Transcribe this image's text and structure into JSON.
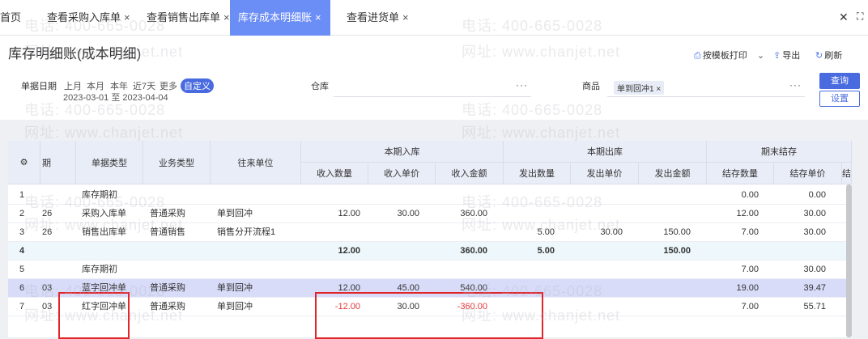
{
  "tabs": [
    {
      "label": "首页",
      "closable": false
    },
    {
      "label": "查看采购入库单",
      "closable": true
    },
    {
      "label": "查看销售出库单",
      "closable": true
    },
    {
      "label": "库存成本明细账",
      "closable": true,
      "active": true
    },
    {
      "label": "查看进货单",
      "closable": true
    }
  ],
  "tab_close": "×",
  "page_title": "库存明细账(成本明细)",
  "toolbar": {
    "print": "按模板打印",
    "export": "导出",
    "refresh": "刷新"
  },
  "filters": {
    "date_label": "单据日期",
    "quick": [
      "上月",
      "本月",
      "本年",
      "近7天",
      "更多",
      "自定义"
    ],
    "range": "2023-03-01 至 2023-04-04",
    "warehouse_label": "仓库",
    "product_label": "商品",
    "product_tag": "单到回冲1 ×",
    "dots": "···"
  },
  "buttons": {
    "query": "查询",
    "settings": "设置"
  },
  "table": {
    "headers": {
      "gear": "⚙",
      "date": "期",
      "doc_type": "单据类型",
      "biz_type": "业务类型",
      "partner": "往来单位",
      "in_group": "本期入库",
      "out_group": "本期出库",
      "end_group": "期末结存",
      "in_qty": "收入数量",
      "in_price": "收入单价",
      "in_amt": "收入金额",
      "out_qty": "发出数量",
      "out_price": "发出单价",
      "out_amt": "发出金额",
      "end_qty": "结存数量",
      "end_price": "结存单价",
      "end_more": "结"
    },
    "rows": [
      {
        "no": "1",
        "date": "",
        "doc": "库存期初",
        "biz": "",
        "partner": "",
        "in_qty": "",
        "in_price": "",
        "in_amt": "",
        "out_qty": "",
        "out_price": "",
        "out_amt": "",
        "end_qty": "0.00",
        "end_price": "0.00"
      },
      {
        "no": "2",
        "date": "26",
        "doc": "采购入库单",
        "biz": "普通采购",
        "partner": "单到回冲",
        "in_qty": "12.00",
        "in_price": "30.00",
        "in_amt": "360.00",
        "out_qty": "",
        "out_price": "",
        "out_amt": "",
        "end_qty": "12.00",
        "end_price": "30.00"
      },
      {
        "no": "3",
        "date": "26",
        "doc": "销售出库单",
        "biz": "普通销售",
        "partner": "销售分开流程1",
        "in_qty": "",
        "in_price": "",
        "in_amt": "",
        "out_qty": "5.00",
        "out_price": "30.00",
        "out_amt": "150.00",
        "end_qty": "7.00",
        "end_price": "30.00"
      },
      {
        "no": "4",
        "date": "",
        "doc": "",
        "biz": "",
        "partner": "",
        "in_qty": "12.00",
        "in_price": "",
        "in_amt": "360.00",
        "out_qty": "5.00",
        "out_price": "",
        "out_amt": "150.00",
        "end_qty": "",
        "end_price": ""
      },
      {
        "no": "5",
        "date": "",
        "doc": "库存期初",
        "biz": "",
        "partner": "",
        "in_qty": "",
        "in_price": "",
        "in_amt": "",
        "out_qty": "",
        "out_price": "",
        "out_amt": "",
        "end_qty": "7.00",
        "end_price": "30.00"
      },
      {
        "no": "6",
        "date": "03",
        "doc": "蓝字回冲单",
        "biz": "普通采购",
        "partner": "单到回冲",
        "in_qty": "12.00",
        "in_price": "45.00",
        "in_amt": "540.00",
        "out_qty": "",
        "out_price": "",
        "out_amt": "",
        "end_qty": "19.00",
        "end_price": "39.47"
      },
      {
        "no": "7",
        "date": "03",
        "doc": "红字回冲单",
        "biz": "普通采购",
        "partner": "单到回冲",
        "in_qty": "-12.00",
        "in_price": "30.00",
        "in_amt": "-360.00",
        "out_qty": "",
        "out_price": "",
        "out_amt": "",
        "end_qty": "7.00",
        "end_price": "55.71"
      }
    ]
  },
  "watermark": {
    "phone": "电话: 400-665-0028",
    "site": "网址: www.chanjet.net"
  },
  "colors": {
    "accent": "#4a6be0",
    "active_tab": "#6b8df6",
    "highlight_row": "#d9dcf9",
    "red": "#e33a3a",
    "box": "#e0262b"
  }
}
